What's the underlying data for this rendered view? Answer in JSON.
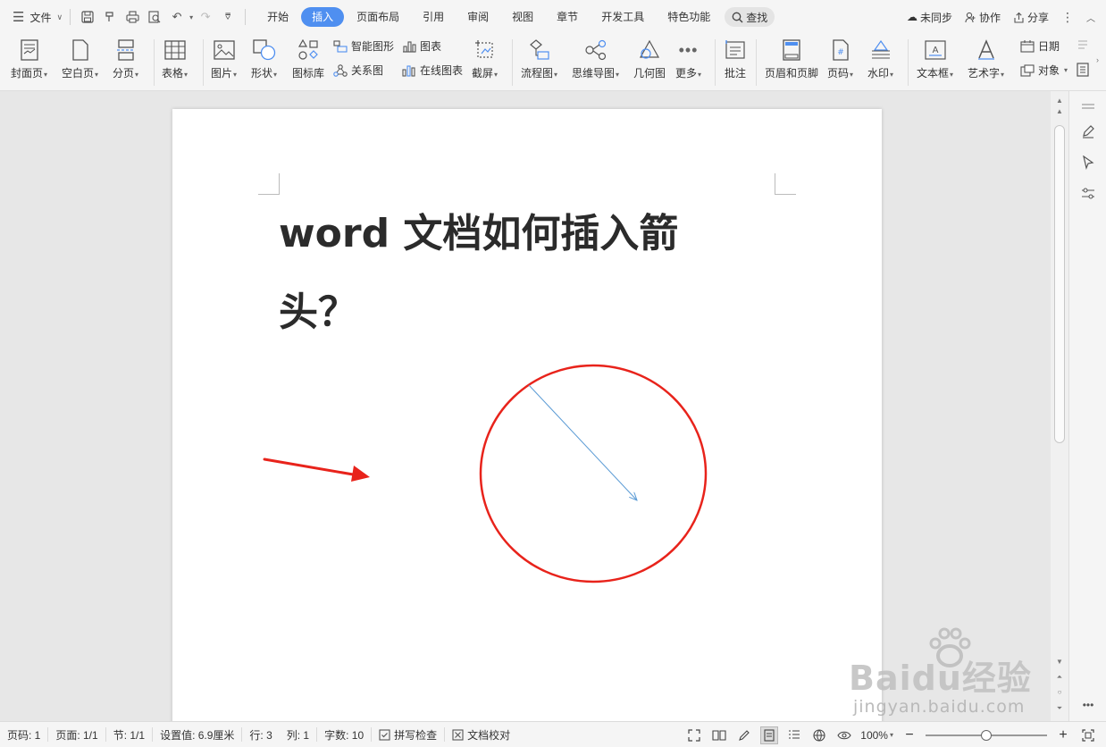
{
  "menubar": {
    "file_label": "文件",
    "tabs": [
      {
        "label": "开始"
      },
      {
        "label": "插入"
      },
      {
        "label": "页面布局"
      },
      {
        "label": "引用"
      },
      {
        "label": "审阅"
      },
      {
        "label": "视图"
      },
      {
        "label": "章节"
      },
      {
        "label": "开发工具"
      },
      {
        "label": "特色功能"
      }
    ],
    "active_tab": "插入",
    "search_label": "查找",
    "unsynced_label": "未同步",
    "collab_label": "协作",
    "share_label": "分享"
  },
  "ribbon": {
    "cover_page": "封面页",
    "blank_page": "空白页",
    "page_break": "分页",
    "table": "表格",
    "picture": "图片",
    "shapes": "形状",
    "icon_library": "图标库",
    "smart_art": "智能图形",
    "relation_chart": "关系图",
    "chart": "图表",
    "online_chart": "在线图表",
    "screenshot": "截屏",
    "flowchart": "流程图",
    "mind_map": "思维导图",
    "geometry": "几何图",
    "more": "更多",
    "comment": "批注",
    "header_footer": "页眉和页脚",
    "page_number": "页码",
    "watermark": "水印",
    "text_box": "文本框",
    "word_art": "艺术字",
    "date": "日期",
    "object": "对象"
  },
  "document": {
    "title": "word 文档如何插入箭头？"
  },
  "statusbar": {
    "page_number": "页码: 1",
    "pages": "页面: 1/1",
    "section": "节: 1/1",
    "setting": "设置值: 6.9厘米",
    "row": "行: 3",
    "column": "列: 1",
    "word_count": "字数: 10",
    "spell_check": "拼写检查",
    "doc_proofread": "文档校对",
    "zoom": "100%"
  },
  "watermark": {
    "brand": "Baidu经验",
    "url": "jingyan.baidu.com"
  },
  "colors": {
    "accent": "#4f8ff0",
    "red_annotation": "#e8231b",
    "arrow_line": "#5b9bd5"
  }
}
